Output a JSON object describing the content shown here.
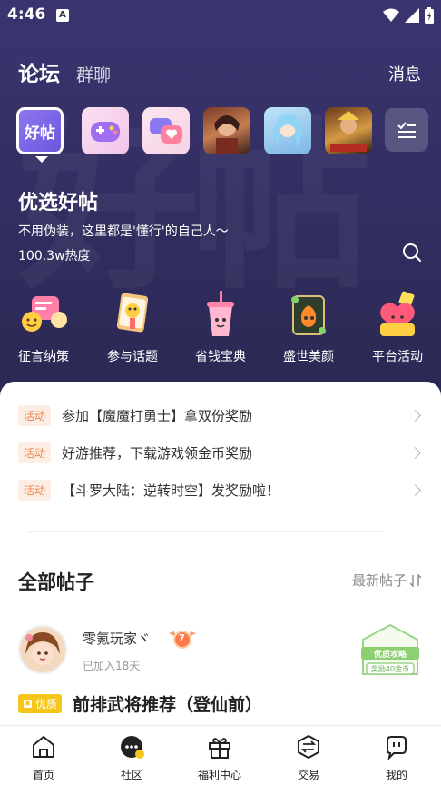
{
  "status_bar": {
    "time": "4:46",
    "notification_icon": "a-icon"
  },
  "header": {
    "tabs": [
      {
        "label": "论坛",
        "active": true
      },
      {
        "label": "群聊",
        "active": false
      }
    ],
    "messages_label": "消息"
  },
  "forums": {
    "active_label": "好帖",
    "items": [
      "good-posts-icon",
      "gamepad-icon",
      "chat-heart-icon",
      "game-hero-1-icon",
      "game-hero-2-icon",
      "game-hero-3-icon",
      "more-list-icon"
    ]
  },
  "hero": {
    "title": "优选好帖",
    "subtitle": "不用伪装，这里都是'懂行'的自己人～",
    "heat": "100.3w热度",
    "watermark": "好帖"
  },
  "categories": [
    {
      "label": "征言纳策",
      "icon": "chat-bubbles-icon"
    },
    {
      "label": "参与话题",
      "icon": "topic-card-icon"
    },
    {
      "label": "省钱宝典",
      "icon": "drink-cup-icon"
    },
    {
      "label": "盛世美颜",
      "icon": "beauty-frame-icon"
    },
    {
      "label": "平台活动",
      "icon": "gift-heart-icon"
    }
  ],
  "activities": [
    {
      "badge": "活动",
      "text": "参加【魔魔打勇士】拿双份奖励"
    },
    {
      "badge": "活动",
      "text": "好游推荐，下载游戏领金币奖励"
    },
    {
      "badge": "活动",
      "text": "【斗罗大陆：逆转时空】发奖励啦！"
    }
  ],
  "posts_section": {
    "title": "全部帖子",
    "sort_label": "最新帖子"
  },
  "post": {
    "username": "零氪玩家ヾ",
    "level": "7",
    "joined": "已加入18天",
    "stamp_line1": "优质攻略",
    "stamp_line2": "奖励40金币",
    "quality_badge": "优质",
    "title": "前排武将推荐（登仙前）"
  },
  "bottom_nav": [
    {
      "label": "首页",
      "icon": "home-icon"
    },
    {
      "label": "社区",
      "icon": "community-icon"
    },
    {
      "label": "福利中心",
      "icon": "gift-box-icon"
    },
    {
      "label": "交易",
      "icon": "exchange-icon"
    },
    {
      "label": "我的",
      "icon": "profile-icon"
    }
  ],
  "colors": {
    "hero_bg": "#332f63",
    "accent_orange": "#e98550",
    "quality_yellow": "#f6c51a",
    "stamp_green": "#7cc26a"
  }
}
